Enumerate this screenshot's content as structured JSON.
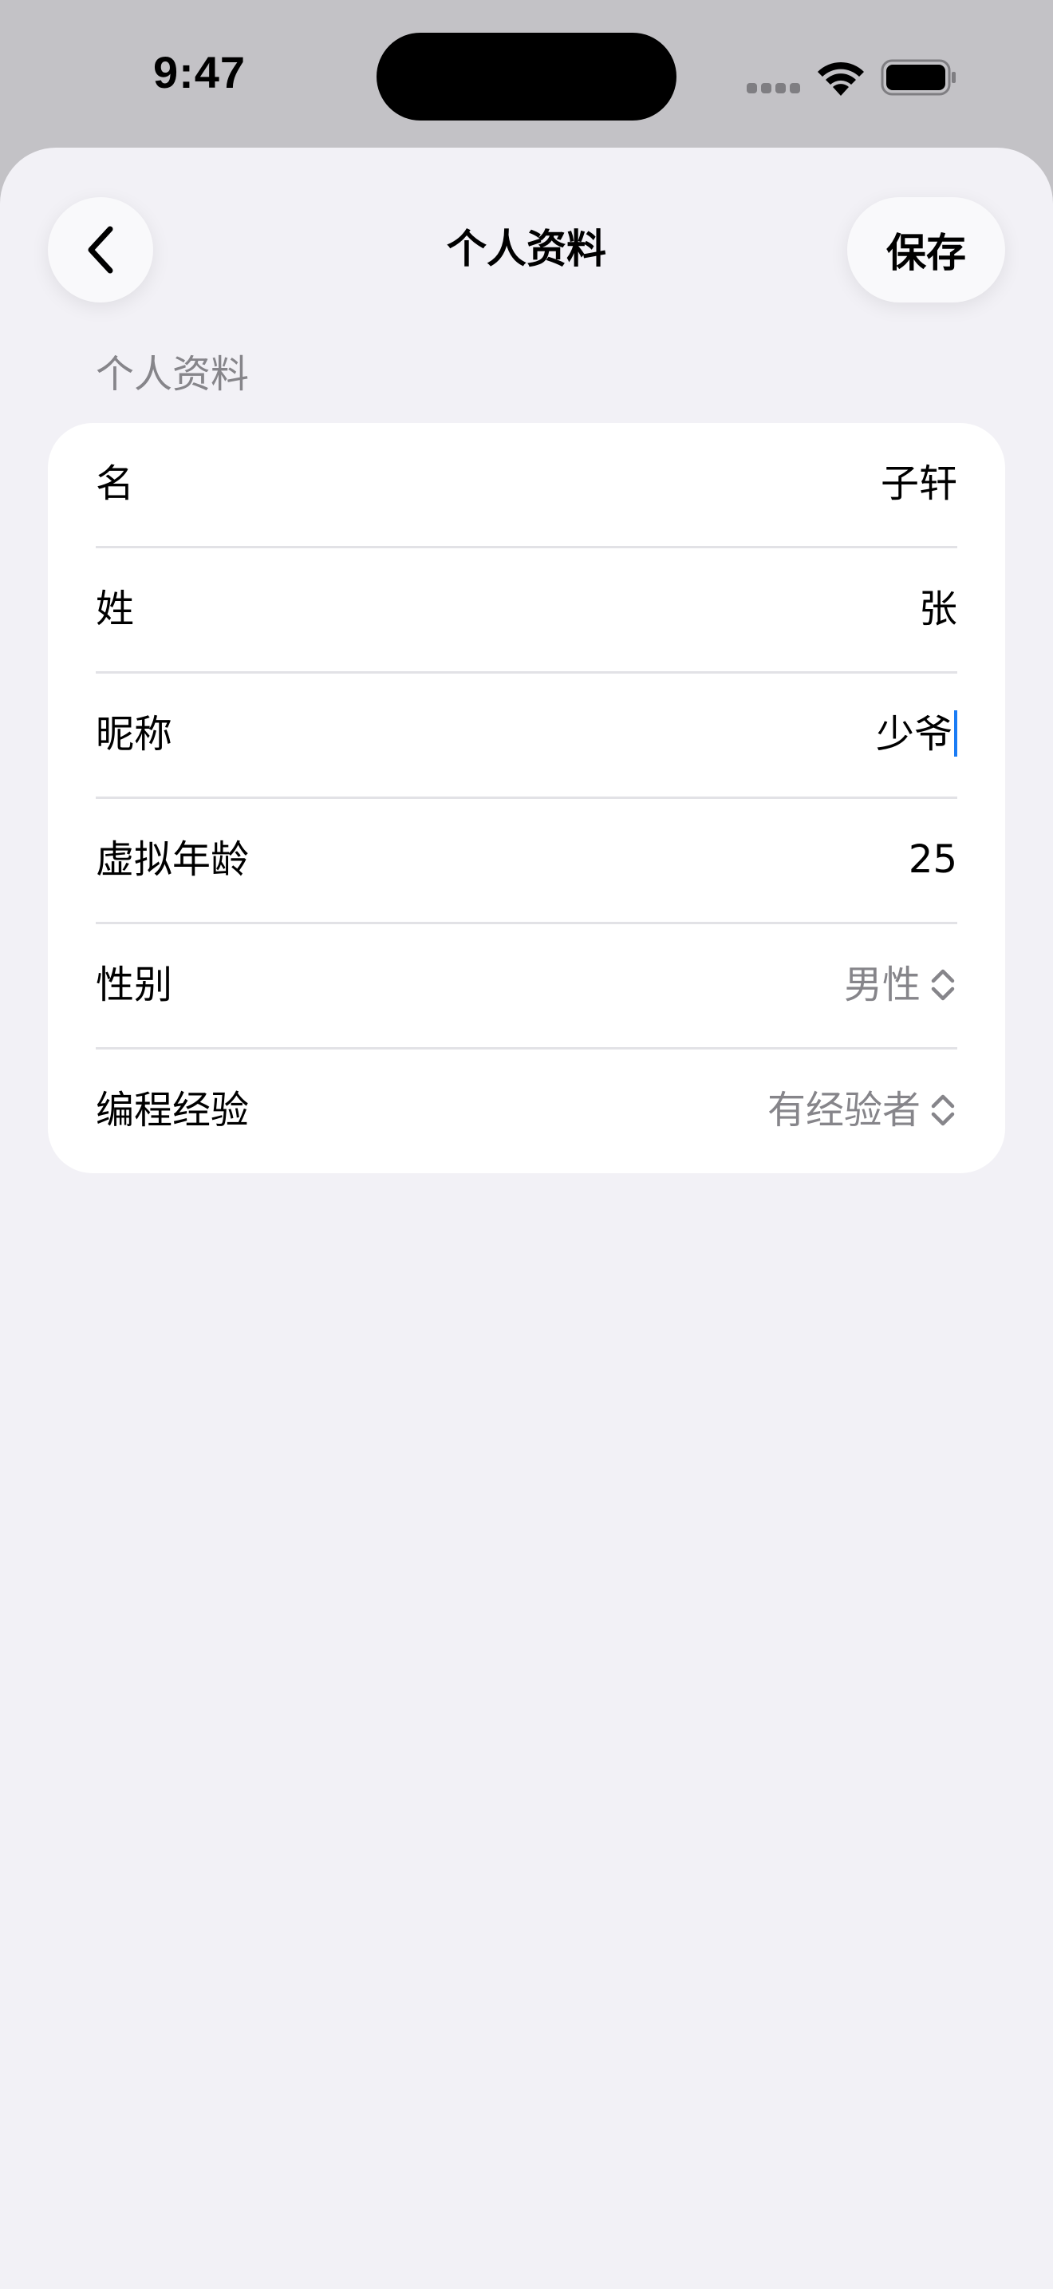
{
  "status_bar": {
    "time": "9:47",
    "icons": [
      "cellular-dots-icon",
      "wifi-icon",
      "battery-icon"
    ]
  },
  "nav": {
    "back_icon": "chevron-left-icon",
    "title": "个人资料",
    "save_label": "保存"
  },
  "section": {
    "header": "个人资料"
  },
  "fields": [
    {
      "label": "名",
      "value": "子轩"
    },
    {
      "label": "姓",
      "value": "张"
    },
    {
      "label": "昵称",
      "value": "少爷"
    },
    {
      "label": "虚拟年龄",
      "value": "25"
    },
    {
      "label": "性别",
      "value": "男性"
    },
    {
      "label": "编程经验",
      "value": "有经验者"
    }
  ],
  "colors": {
    "background": "#f2f1f6",
    "status_bg": "#c3c2c6",
    "card": "#ffffff",
    "secondary_text": "#86858a",
    "cursor": "#1a7cf5"
  }
}
